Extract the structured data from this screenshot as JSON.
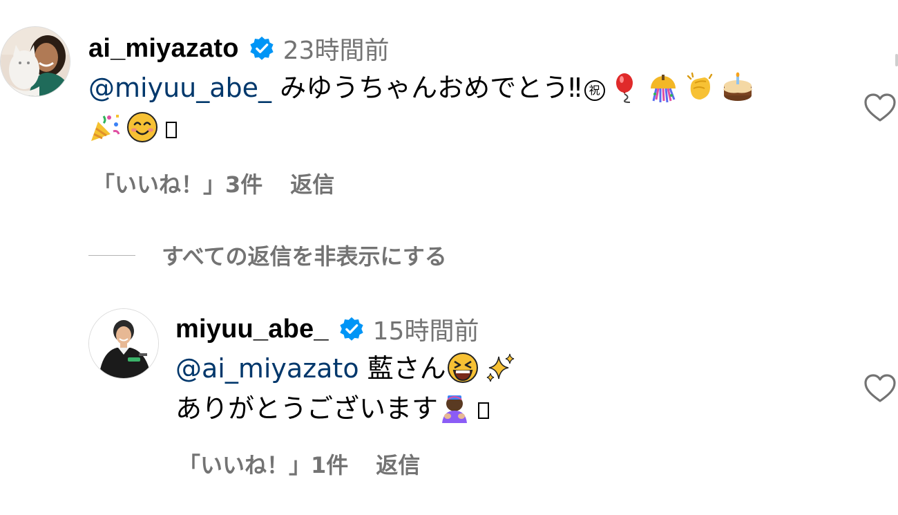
{
  "comment": {
    "username": "ai_miyazato",
    "timestamp": "23時間前",
    "mention": "@miyuu_abe_",
    "text": "みゆうちゃんおめでとう‼",
    "circled_char": "祝",
    "emojis_line1": [
      "balloon",
      "confetti-ball",
      "clapping-hands",
      "birthday-cake"
    ],
    "emojis_line2": [
      "party-popper",
      "smiling-face"
    ],
    "likes_label": "「いいね！」3件",
    "reply_label": "返信"
  },
  "hide_replies_label": "すべての返信を非表示にする",
  "reply": {
    "username": "miyuu_abe_",
    "timestamp": "15時間前",
    "mention": "@ai_miyazato",
    "text_line1": "藍さん",
    "text_line2": "ありがとうございます",
    "emojis_line1": [
      "grinning-squinting-face",
      "sparkles"
    ],
    "emojis_line2": [
      "person-bowing"
    ],
    "likes_label": "「いいね！」1件",
    "reply_label": "返信"
  },
  "colors": {
    "mention": "#00376b",
    "secondary_text": "#737373",
    "verified_badge": "#0095f6"
  }
}
